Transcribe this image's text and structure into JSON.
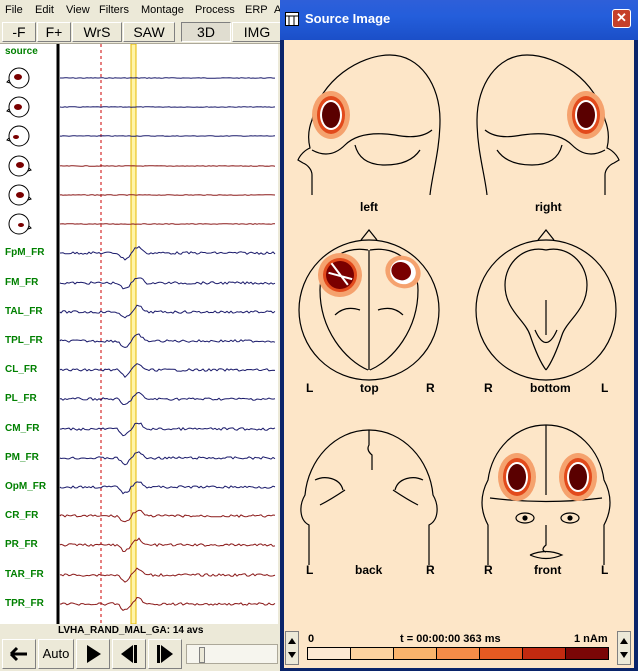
{
  "menu": [
    "File",
    "Edit",
    "View",
    "Filters",
    "Montage",
    "Process",
    "ERP",
    "A"
  ],
  "toolbar": {
    "minus_f": "-F",
    "plus_f": "F+",
    "wrs": "WrS",
    "saw": "SAW",
    "three_d": "3D",
    "img": "IMG"
  },
  "eeg": {
    "source_label": "source",
    "channels": [
      "FpM_FR",
      "FM_FR",
      "TAL_FR",
      "TPL_FR",
      "CL_FR",
      "PL_FR",
      "CM_FR",
      "PM_FR",
      "OpM_FR",
      "CR_FR",
      "PR_FR",
      "TAR_FR",
      "TPR_FR"
    ],
    "footer": "LVHA_RAND_MAL_GA: 14 avs"
  },
  "controls": {
    "auto": "Auto"
  },
  "window": {
    "title": "Source Image",
    "views": {
      "left": "left",
      "right": "right",
      "top": "top",
      "bottom": "bottom",
      "back": "back",
      "front": "front",
      "L": "L",
      "R": "R"
    },
    "status": {
      "min": "0",
      "time": "t = 00:00:00  363 ms",
      "max": "1 nAm"
    },
    "colors": {
      "background": "#fde6c8",
      "source_dark": "#5a0000",
      "source_mid": "#c8281a",
      "source_light": "#f5a26e"
    }
  }
}
